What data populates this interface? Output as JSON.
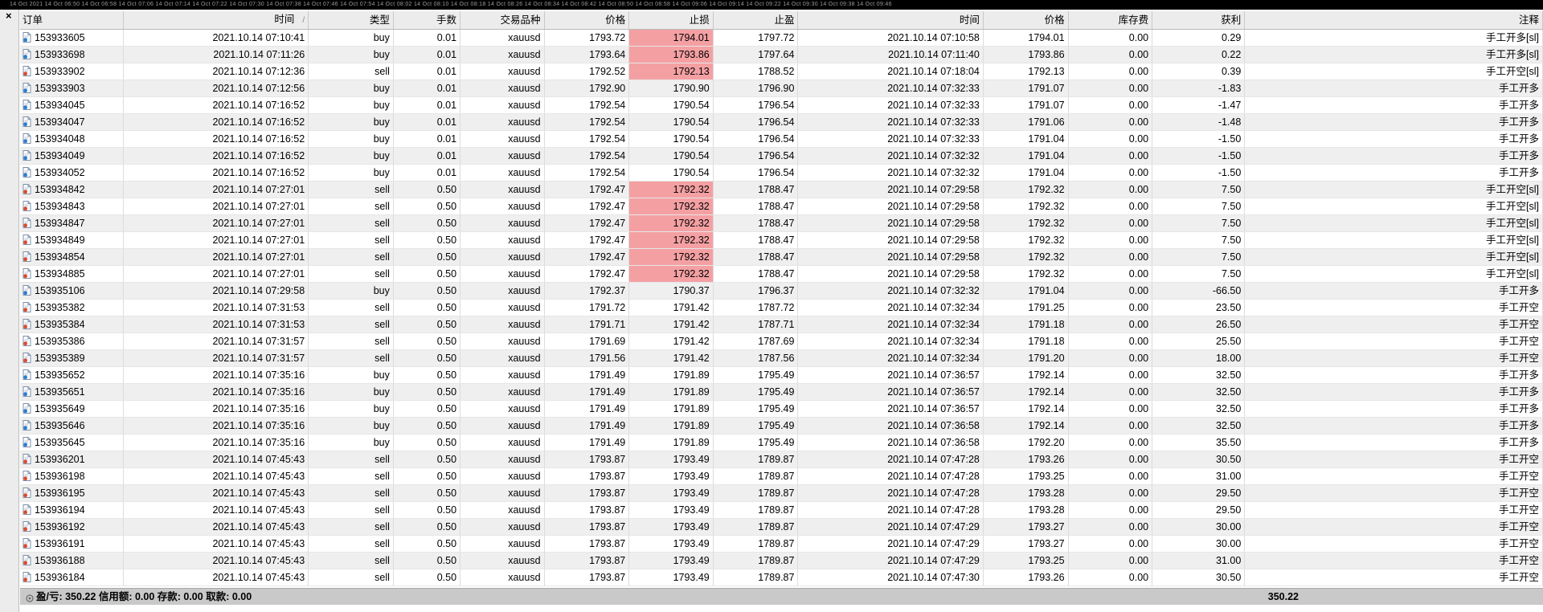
{
  "top_strip_text": "14 Oct 2021   14 Oct 06:50   14 Oct 06:58   14 Oct 07:06   14 Oct 07:14   14 Oct 07:22   14 Oct 07:30   14 Oct 07:38   14 Oct 07:46   14 Oct 07:54   14 Oct 08:02   14 Oct 08:10   14 Oct 08:18   14 Oct 08:26   14 Oct 08:34   14 Oct 08:42   14 Oct 08:50   14 Oct 08:58   14 Oct 09:06   14 Oct 09:14   14 Oct 09:22   14 Oct 09:30   14 Oct 09:38   14 Oct 09:46",
  "close_label": "×",
  "columns": [
    "订单",
    "时间",
    "类型",
    "手数",
    "交易品种",
    "价格",
    "止损",
    "止盈",
    "时间",
    "价格",
    "库存费",
    "获利",
    "注释"
  ],
  "sort_indicator": "/",
  "rows": [
    {
      "order": "153933605",
      "open_time": "2021.10.14 07:10:41",
      "type": "buy",
      "lots": "0.01",
      "symbol": "xauusd",
      "open_price": "1793.72",
      "sl": "1794.01",
      "tp": "1797.72",
      "close_time": "2021.10.14 07:10:58",
      "close_price": "1794.01",
      "swap": "0.00",
      "profit": "0.29",
      "comment": "手工开多[sl]",
      "sl_hit": true
    },
    {
      "order": "153933698",
      "open_time": "2021.10.14 07:11:26",
      "type": "buy",
      "lots": "0.01",
      "symbol": "xauusd",
      "open_price": "1793.64",
      "sl": "1793.86",
      "tp": "1797.64",
      "close_time": "2021.10.14 07:11:40",
      "close_price": "1793.86",
      "swap": "0.00",
      "profit": "0.22",
      "comment": "手工开多[sl]",
      "sl_hit": true
    },
    {
      "order": "153933902",
      "open_time": "2021.10.14 07:12:36",
      "type": "sell",
      "lots": "0.01",
      "symbol": "xauusd",
      "open_price": "1792.52",
      "sl": "1792.13",
      "tp": "1788.52",
      "close_time": "2021.10.14 07:18:04",
      "close_price": "1792.13",
      "swap": "0.00",
      "profit": "0.39",
      "comment": "手工开空[sl]",
      "sl_hit": true
    },
    {
      "order": "153933903",
      "open_time": "2021.10.14 07:12:56",
      "type": "buy",
      "lots": "0.01",
      "symbol": "xauusd",
      "open_price": "1792.90",
      "sl": "1790.90",
      "tp": "1796.90",
      "close_time": "2021.10.14 07:32:33",
      "close_price": "1791.07",
      "swap": "0.00",
      "profit": "-1.83",
      "comment": "手工开多",
      "sl_hit": false
    },
    {
      "order": "153934045",
      "open_time": "2021.10.14 07:16:52",
      "type": "buy",
      "lots": "0.01",
      "symbol": "xauusd",
      "open_price": "1792.54",
      "sl": "1790.54",
      "tp": "1796.54",
      "close_time": "2021.10.14 07:32:33",
      "close_price": "1791.07",
      "swap": "0.00",
      "profit": "-1.47",
      "comment": "手工开多",
      "sl_hit": false
    },
    {
      "order": "153934047",
      "open_time": "2021.10.14 07:16:52",
      "type": "buy",
      "lots": "0.01",
      "symbol": "xauusd",
      "open_price": "1792.54",
      "sl": "1790.54",
      "tp": "1796.54",
      "close_time": "2021.10.14 07:32:33",
      "close_price": "1791.06",
      "swap": "0.00",
      "profit": "-1.48",
      "comment": "手工开多",
      "sl_hit": false
    },
    {
      "order": "153934048",
      "open_time": "2021.10.14 07:16:52",
      "type": "buy",
      "lots": "0.01",
      "symbol": "xauusd",
      "open_price": "1792.54",
      "sl": "1790.54",
      "tp": "1796.54",
      "close_time": "2021.10.14 07:32:33",
      "close_price": "1791.04",
      "swap": "0.00",
      "profit": "-1.50",
      "comment": "手工开多",
      "sl_hit": false
    },
    {
      "order": "153934049",
      "open_time": "2021.10.14 07:16:52",
      "type": "buy",
      "lots": "0.01",
      "symbol": "xauusd",
      "open_price": "1792.54",
      "sl": "1790.54",
      "tp": "1796.54",
      "close_time": "2021.10.14 07:32:32",
      "close_price": "1791.04",
      "swap": "0.00",
      "profit": "-1.50",
      "comment": "手工开多",
      "sl_hit": false
    },
    {
      "order": "153934052",
      "open_time": "2021.10.14 07:16:52",
      "type": "buy",
      "lots": "0.01",
      "symbol": "xauusd",
      "open_price": "1792.54",
      "sl": "1790.54",
      "tp": "1796.54",
      "close_time": "2021.10.14 07:32:32",
      "close_price": "1791.04",
      "swap": "0.00",
      "profit": "-1.50",
      "comment": "手工开多",
      "sl_hit": false
    },
    {
      "order": "153934842",
      "open_time": "2021.10.14 07:27:01",
      "type": "sell",
      "lots": "0.50",
      "symbol": "xauusd",
      "open_price": "1792.47",
      "sl": "1792.32",
      "tp": "1788.47",
      "close_time": "2021.10.14 07:29:58",
      "close_price": "1792.32",
      "swap": "0.00",
      "profit": "7.50",
      "comment": "手工开空[sl]",
      "sl_hit": true
    },
    {
      "order": "153934843",
      "open_time": "2021.10.14 07:27:01",
      "type": "sell",
      "lots": "0.50",
      "symbol": "xauusd",
      "open_price": "1792.47",
      "sl": "1792.32",
      "tp": "1788.47",
      "close_time": "2021.10.14 07:29:58",
      "close_price": "1792.32",
      "swap": "0.00",
      "profit": "7.50",
      "comment": "手工开空[sl]",
      "sl_hit": true
    },
    {
      "order": "153934847",
      "open_time": "2021.10.14 07:27:01",
      "type": "sell",
      "lots": "0.50",
      "symbol": "xauusd",
      "open_price": "1792.47",
      "sl": "1792.32",
      "tp": "1788.47",
      "close_time": "2021.10.14 07:29:58",
      "close_price": "1792.32",
      "swap": "0.00",
      "profit": "7.50",
      "comment": "手工开空[sl]",
      "sl_hit": true
    },
    {
      "order": "153934849",
      "open_time": "2021.10.14 07:27:01",
      "type": "sell",
      "lots": "0.50",
      "symbol": "xauusd",
      "open_price": "1792.47",
      "sl": "1792.32",
      "tp": "1788.47",
      "close_time": "2021.10.14 07:29:58",
      "close_price": "1792.32",
      "swap": "0.00",
      "profit": "7.50",
      "comment": "手工开空[sl]",
      "sl_hit": true
    },
    {
      "order": "153934854",
      "open_time": "2021.10.14 07:27:01",
      "type": "sell",
      "lots": "0.50",
      "symbol": "xauusd",
      "open_price": "1792.47",
      "sl": "1792.32",
      "tp": "1788.47",
      "close_time": "2021.10.14 07:29:58",
      "close_price": "1792.32",
      "swap": "0.00",
      "profit": "7.50",
      "comment": "手工开空[sl]",
      "sl_hit": true
    },
    {
      "order": "153934885",
      "open_time": "2021.10.14 07:27:01",
      "type": "sell",
      "lots": "0.50",
      "symbol": "xauusd",
      "open_price": "1792.47",
      "sl": "1792.32",
      "tp": "1788.47",
      "close_time": "2021.10.14 07:29:58",
      "close_price": "1792.32",
      "swap": "0.00",
      "profit": "7.50",
      "comment": "手工开空[sl]",
      "sl_hit": true
    },
    {
      "order": "153935106",
      "open_time": "2021.10.14 07:29:58",
      "type": "buy",
      "lots": "0.50",
      "symbol": "xauusd",
      "open_price": "1792.37",
      "sl": "1790.37",
      "tp": "1796.37",
      "close_time": "2021.10.14 07:32:32",
      "close_price": "1791.04",
      "swap": "0.00",
      "profit": "-66.50",
      "comment": "手工开多",
      "sl_hit": false
    },
    {
      "order": "153935382",
      "open_time": "2021.10.14 07:31:53",
      "type": "sell",
      "lots": "0.50",
      "symbol": "xauusd",
      "open_price": "1791.72",
      "sl": "1791.42",
      "tp": "1787.72",
      "close_time": "2021.10.14 07:32:34",
      "close_price": "1791.25",
      "swap": "0.00",
      "profit": "23.50",
      "comment": "手工开空",
      "sl_hit": false
    },
    {
      "order": "153935384",
      "open_time": "2021.10.14 07:31:53",
      "type": "sell",
      "lots": "0.50",
      "symbol": "xauusd",
      "open_price": "1791.71",
      "sl": "1791.42",
      "tp": "1787.71",
      "close_time": "2021.10.14 07:32:34",
      "close_price": "1791.18",
      "swap": "0.00",
      "profit": "26.50",
      "comment": "手工开空",
      "sl_hit": false
    },
    {
      "order": "153935386",
      "open_time": "2021.10.14 07:31:57",
      "type": "sell",
      "lots": "0.50",
      "symbol": "xauusd",
      "open_price": "1791.69",
      "sl": "1791.42",
      "tp": "1787.69",
      "close_time": "2021.10.14 07:32:34",
      "close_price": "1791.18",
      "swap": "0.00",
      "profit": "25.50",
      "comment": "手工开空",
      "sl_hit": false
    },
    {
      "order": "153935389",
      "open_time": "2021.10.14 07:31:57",
      "type": "sell",
      "lots": "0.50",
      "symbol": "xauusd",
      "open_price": "1791.56",
      "sl": "1791.42",
      "tp": "1787.56",
      "close_time": "2021.10.14 07:32:34",
      "close_price": "1791.20",
      "swap": "0.00",
      "profit": "18.00",
      "comment": "手工开空",
      "sl_hit": false
    },
    {
      "order": "153935652",
      "open_time": "2021.10.14 07:35:16",
      "type": "buy",
      "lots": "0.50",
      "symbol": "xauusd",
      "open_price": "1791.49",
      "sl": "1791.89",
      "tp": "1795.49",
      "close_time": "2021.10.14 07:36:57",
      "close_price": "1792.14",
      "swap": "0.00",
      "profit": "32.50",
      "comment": "手工开多",
      "sl_hit": false
    },
    {
      "order": "153935651",
      "open_time": "2021.10.14 07:35:16",
      "type": "buy",
      "lots": "0.50",
      "symbol": "xauusd",
      "open_price": "1791.49",
      "sl": "1791.89",
      "tp": "1795.49",
      "close_time": "2021.10.14 07:36:57",
      "close_price": "1792.14",
      "swap": "0.00",
      "profit": "32.50",
      "comment": "手工开多",
      "sl_hit": false
    },
    {
      "order": "153935649",
      "open_time": "2021.10.14 07:35:16",
      "type": "buy",
      "lots": "0.50",
      "symbol": "xauusd",
      "open_price": "1791.49",
      "sl": "1791.89",
      "tp": "1795.49",
      "close_time": "2021.10.14 07:36:57",
      "close_price": "1792.14",
      "swap": "0.00",
      "profit": "32.50",
      "comment": "手工开多",
      "sl_hit": false
    },
    {
      "order": "153935646",
      "open_time": "2021.10.14 07:35:16",
      "type": "buy",
      "lots": "0.50",
      "symbol": "xauusd",
      "open_price": "1791.49",
      "sl": "1791.89",
      "tp": "1795.49",
      "close_time": "2021.10.14 07:36:58",
      "close_price": "1792.14",
      "swap": "0.00",
      "profit": "32.50",
      "comment": "手工开多",
      "sl_hit": false
    },
    {
      "order": "153935645",
      "open_time": "2021.10.14 07:35:16",
      "type": "buy",
      "lots": "0.50",
      "symbol": "xauusd",
      "open_price": "1791.49",
      "sl": "1791.89",
      "tp": "1795.49",
      "close_time": "2021.10.14 07:36:58",
      "close_price": "1792.20",
      "swap": "0.00",
      "profit": "35.50",
      "comment": "手工开多",
      "sl_hit": false
    },
    {
      "order": "153936201",
      "open_time": "2021.10.14 07:45:43",
      "type": "sell",
      "lots": "0.50",
      "symbol": "xauusd",
      "open_price": "1793.87",
      "sl": "1793.49",
      "tp": "1789.87",
      "close_time": "2021.10.14 07:47:28",
      "close_price": "1793.26",
      "swap": "0.00",
      "profit": "30.50",
      "comment": "手工开空",
      "sl_hit": false
    },
    {
      "order": "153936198",
      "open_time": "2021.10.14 07:45:43",
      "type": "sell",
      "lots": "0.50",
      "symbol": "xauusd",
      "open_price": "1793.87",
      "sl": "1793.49",
      "tp": "1789.87",
      "close_time": "2021.10.14 07:47:28",
      "close_price": "1793.25",
      "swap": "0.00",
      "profit": "31.00",
      "comment": "手工开空",
      "sl_hit": false
    },
    {
      "order": "153936195",
      "open_time": "2021.10.14 07:45:43",
      "type": "sell",
      "lots": "0.50",
      "symbol": "xauusd",
      "open_price": "1793.87",
      "sl": "1793.49",
      "tp": "1789.87",
      "close_time": "2021.10.14 07:47:28",
      "close_price": "1793.28",
      "swap": "0.00",
      "profit": "29.50",
      "comment": "手工开空",
      "sl_hit": false
    },
    {
      "order": "153936194",
      "open_time": "2021.10.14 07:45:43",
      "type": "sell",
      "lots": "0.50",
      "symbol": "xauusd",
      "open_price": "1793.87",
      "sl": "1793.49",
      "tp": "1789.87",
      "close_time": "2021.10.14 07:47:28",
      "close_price": "1793.28",
      "swap": "0.00",
      "profit": "29.50",
      "comment": "手工开空",
      "sl_hit": false
    },
    {
      "order": "153936192",
      "open_time": "2021.10.14 07:45:43",
      "type": "sell",
      "lots": "0.50",
      "symbol": "xauusd",
      "open_price": "1793.87",
      "sl": "1793.49",
      "tp": "1789.87",
      "close_time": "2021.10.14 07:47:29",
      "close_price": "1793.27",
      "swap": "0.00",
      "profit": "30.00",
      "comment": "手工开空",
      "sl_hit": false
    },
    {
      "order": "153936191",
      "open_time": "2021.10.14 07:45:43",
      "type": "sell",
      "lots": "0.50",
      "symbol": "xauusd",
      "open_price": "1793.87",
      "sl": "1793.49",
      "tp": "1789.87",
      "close_time": "2021.10.14 07:47:29",
      "close_price": "1793.27",
      "swap": "0.00",
      "profit": "30.00",
      "comment": "手工开空",
      "sl_hit": false
    },
    {
      "order": "153936188",
      "open_time": "2021.10.14 07:45:43",
      "type": "sell",
      "lots": "0.50",
      "symbol": "xauusd",
      "open_price": "1793.87",
      "sl": "1793.49",
      "tp": "1789.87",
      "close_time": "2021.10.14 07:47:29",
      "close_price": "1793.25",
      "swap": "0.00",
      "profit": "31.00",
      "comment": "手工开空",
      "sl_hit": false
    },
    {
      "order": "153936184",
      "open_time": "2021.10.14 07:45:43",
      "type": "sell",
      "lots": "0.50",
      "symbol": "xauusd",
      "open_price": "1793.87",
      "sl": "1793.49",
      "tp": "1789.87",
      "close_time": "2021.10.14 07:47:30",
      "close_price": "1793.26",
      "swap": "0.00",
      "profit": "30.50",
      "comment": "手工开空",
      "sl_hit": false
    }
  ],
  "summary": {
    "text": "盈/亏: 350.22  信用额: 0.00  存款: 0.00  取款: 0.00",
    "total_profit": "350.22"
  },
  "colors": {
    "sl_highlight": "#f4a0a3",
    "buy_icon": "#2a7fd0",
    "sell_icon": "#e04a2c"
  },
  "icons": {
    "buy": "buy-order-doc-icon",
    "sell": "sell-order-doc-icon",
    "close": "close-icon",
    "summary": "summary-circle-icon"
  }
}
